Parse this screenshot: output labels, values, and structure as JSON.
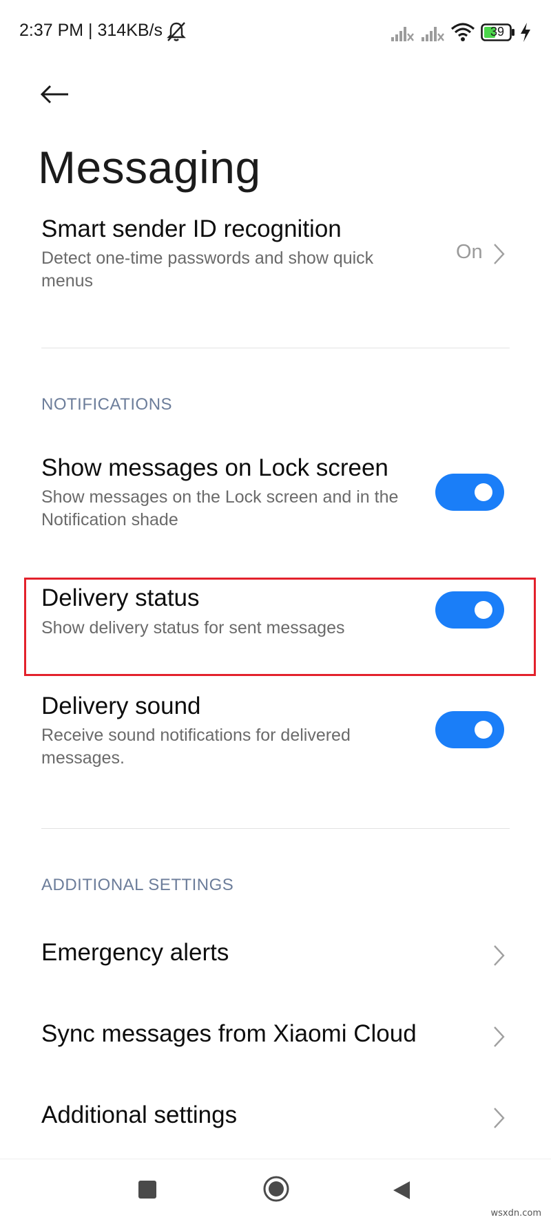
{
  "status_bar": {
    "time": "2:37 PM | 314KB/s",
    "battery_level": "39",
    "icons": [
      "bell-off-icon",
      "signal-icon",
      "signal-icon",
      "wifi-icon",
      "battery-icon",
      "charging-icon"
    ]
  },
  "header": {
    "back_icon": "arrow-left-icon",
    "title": "Messaging"
  },
  "smart_sender": {
    "title": "Smart sender ID recognition",
    "subtitle": "Detect one-time passwords and show quick menus",
    "value": "On"
  },
  "notifications": {
    "section_label": "NOTIFICATIONS",
    "items": [
      {
        "title": "Show messages on Lock screen",
        "subtitle": "Show messages on the Lock screen and in the Notification shade",
        "enabled": true
      },
      {
        "title": "Delivery status",
        "subtitle": "Show delivery status for sent messages",
        "enabled": true
      },
      {
        "title": "Delivery sound",
        "subtitle": "Receive sound notifications for delivered messages.",
        "enabled": true
      }
    ]
  },
  "additional": {
    "section_label": "ADDITIONAL SETTINGS",
    "items": [
      {
        "title": "Emergency alerts"
      },
      {
        "title": "Sync messages from Xiaomi Cloud"
      },
      {
        "title": "Additional settings"
      }
    ]
  },
  "nav_bar": {
    "icons": [
      "recents-square-icon",
      "home-circle-icon",
      "back-triangle-icon"
    ]
  },
  "watermark": "wsxdn.com",
  "colors": {
    "accent": "#1a7ef8",
    "highlight": "#e3212b",
    "section_header": "#6c7d9a",
    "subtitle": "#6a6a6a"
  }
}
